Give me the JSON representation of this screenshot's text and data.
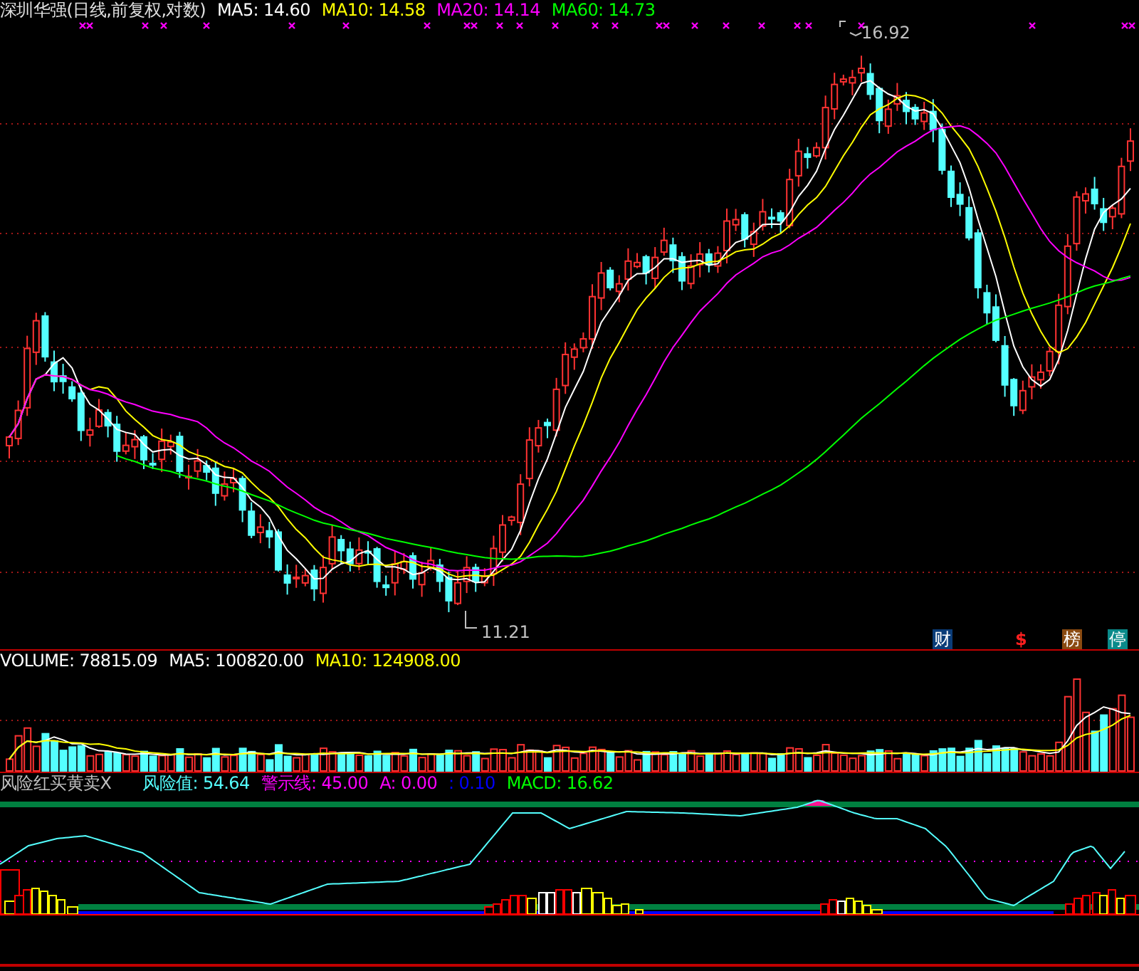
{
  "price_panel": {
    "title": "深圳华强(日线,前复权,对数)",
    "indicators": [
      {
        "label": "MA5: 14.60",
        "color": "#ffffff"
      },
      {
        "label": "MA10: 14.58",
        "color": "#ffff00"
      },
      {
        "label": "MA20: 14.14",
        "color": "#ff00ff"
      },
      {
        "label": "MA60: 14.73",
        "color": "#00ff00"
      }
    ],
    "high_label": "16.92",
    "low_label": "11.21",
    "badges": [
      {
        "kind": "tile",
        "text": "财",
        "color": "#0a3c78"
      },
      {
        "kind": "glyph",
        "text": "$",
        "color": "#ff2020"
      },
      {
        "kind": "tile",
        "text": "榜",
        "color": "#8a4a10"
      },
      {
        "kind": "tile",
        "text": "停",
        "color": "#0a8a8a"
      }
    ]
  },
  "volume_panel": {
    "indicators": [
      {
        "label": "VOLUME: 78815.09",
        "color": "#ffffff"
      },
      {
        "label": "MA5: 100820.00",
        "color": "#ffffff"
      },
      {
        "label": "MA10: 124908.00",
        "color": "#ffff00"
      }
    ]
  },
  "risk_panel": {
    "title": "风险红买黄卖X",
    "indicators": [
      {
        "label": "风险值: 54.64",
        "color": "#54ffff"
      },
      {
        "label": "警示线: 45.00",
        "color": "#ff00ff"
      },
      {
        "label": "A: 0.00",
        "color": "#ff00ff"
      },
      {
        "label": ": 0.10",
        "color": "#0000ff"
      },
      {
        "label": "MACD: 16.62",
        "color": "#00ff00"
      }
    ]
  }
}
